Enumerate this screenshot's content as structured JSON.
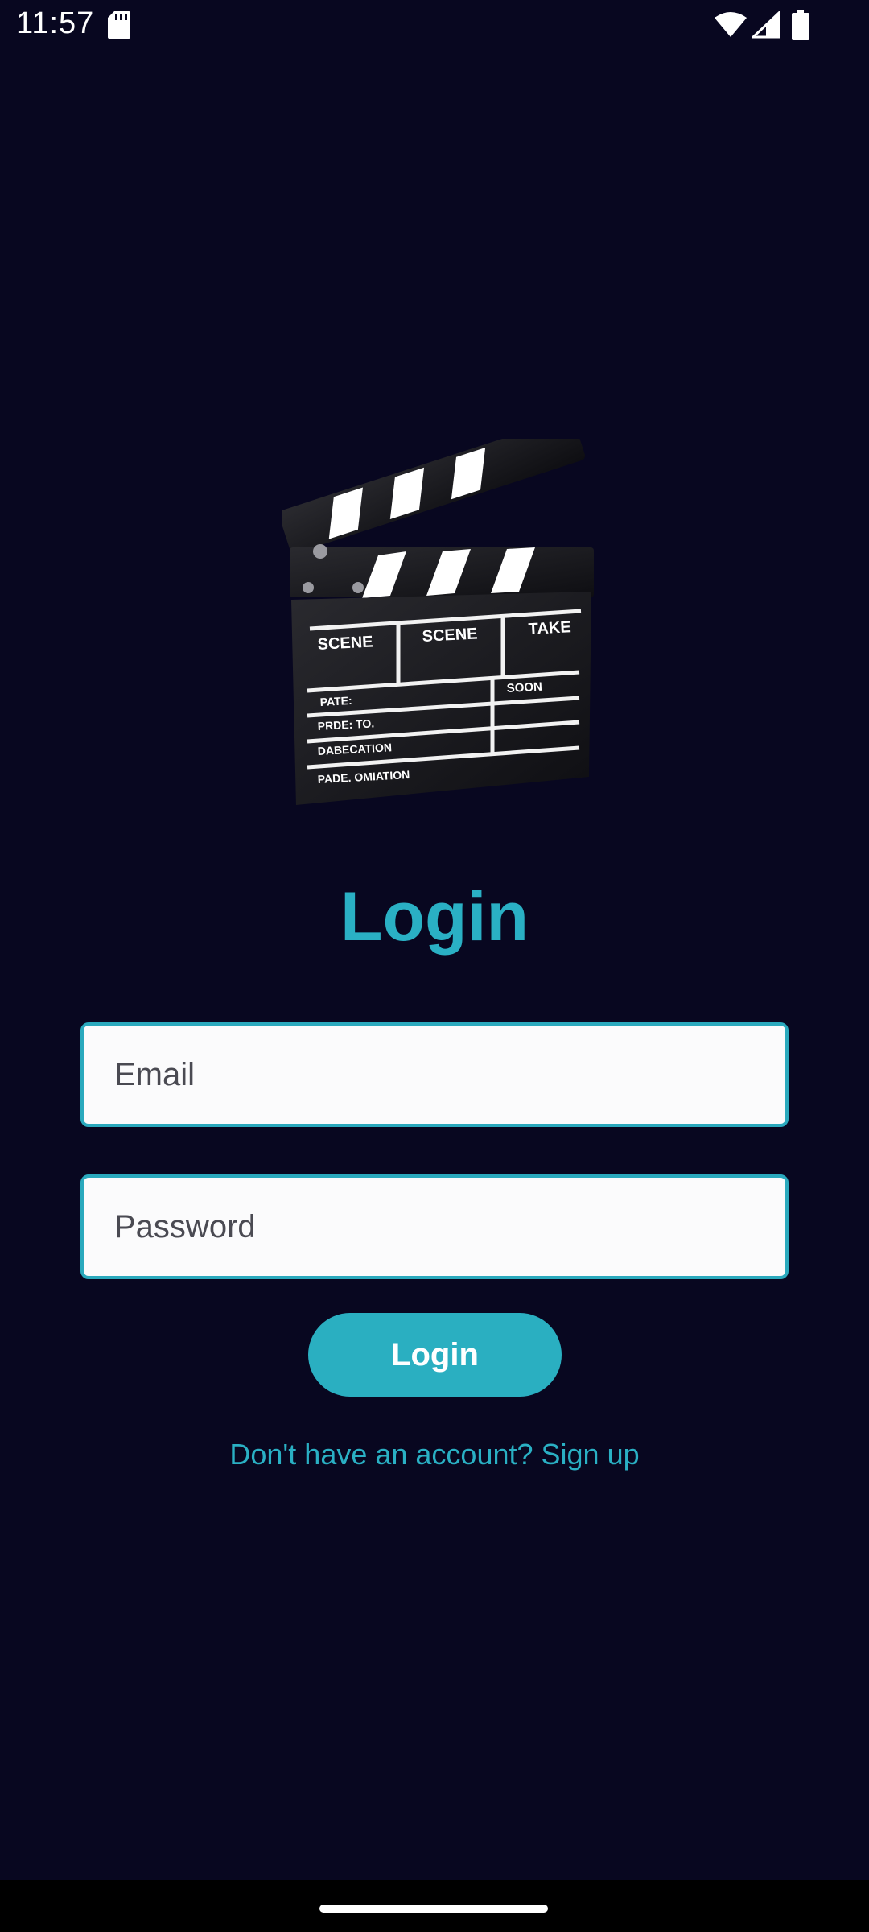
{
  "status_bar": {
    "time": "11:57",
    "icons": [
      "sd-card-icon",
      "wifi-icon",
      "signal-icon",
      "battery-icon"
    ]
  },
  "logo": {
    "icon": "clapperboard-icon",
    "lettering": [
      "SCENE",
      "SCENE",
      "TAKE",
      "PATE:",
      "SOON",
      "PRDE: TO.",
      "DABECATION",
      "PADE. OMIATION"
    ]
  },
  "login": {
    "title": "Login",
    "email_placeholder": "Email",
    "password_placeholder": "Password",
    "button_label": "Login",
    "signup_text": "Don't have an account? Sign up"
  },
  "colors": {
    "background": "#080720",
    "accent": "#2ab0c4",
    "field_background": "#fbfbfc"
  }
}
